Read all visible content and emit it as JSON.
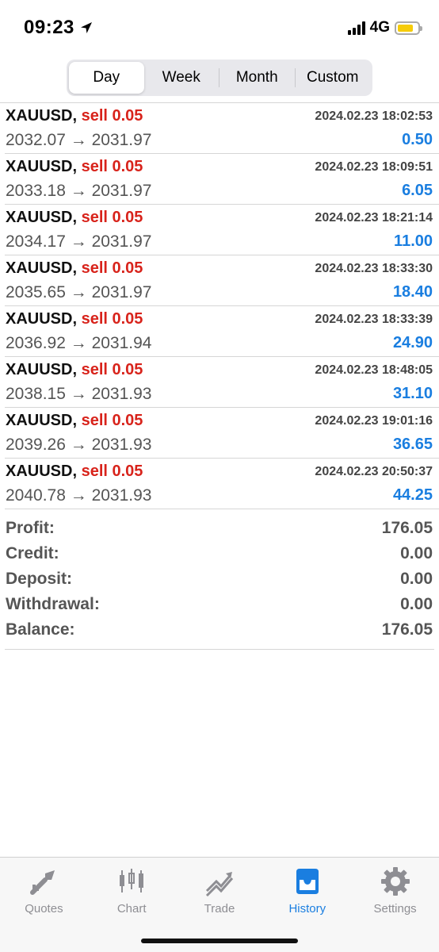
{
  "status_bar": {
    "time": "09:23",
    "network": "4G"
  },
  "periods": [
    {
      "label": "Day",
      "active": true
    },
    {
      "label": "Week",
      "active": false
    },
    {
      "label": "Month",
      "active": false
    },
    {
      "label": "Custom",
      "active": false
    }
  ],
  "deals": [
    {
      "symbol": "XAUUSD,",
      "type": "sell 0.05",
      "time": "2024.02.23 18:02:53",
      "prices": "2032.07 → 2031.97",
      "profit": "0.50"
    },
    {
      "symbol": "XAUUSD,",
      "type": "sell 0.05",
      "time": "2024.02.23 18:09:51",
      "prices": "2033.18 → 2031.97",
      "profit": "6.05"
    },
    {
      "symbol": "XAUUSD,",
      "type": "sell 0.05",
      "time": "2024.02.23 18:21:14",
      "prices": "2034.17 → 2031.97",
      "profit": "11.00"
    },
    {
      "symbol": "XAUUSD,",
      "type": "sell 0.05",
      "time": "2024.02.23 18:33:30",
      "prices": "2035.65 → 2031.97",
      "profit": "18.40"
    },
    {
      "symbol": "XAUUSD,",
      "type": "sell 0.05",
      "time": "2024.02.23 18:33:39",
      "prices": "2036.92 → 2031.94",
      "profit": "24.90"
    },
    {
      "symbol": "XAUUSD,",
      "type": "sell 0.05",
      "time": "2024.02.23 18:48:05",
      "prices": "2038.15 → 2031.93",
      "profit": "31.10"
    },
    {
      "symbol": "XAUUSD,",
      "type": "sell 0.05",
      "time": "2024.02.23 19:01:16",
      "prices": "2039.26 → 2031.93",
      "profit": "36.65"
    },
    {
      "symbol": "XAUUSD,",
      "type": "sell 0.05",
      "time": "2024.02.23 20:50:37",
      "prices": "2040.78 → 2031.93",
      "profit": "44.25"
    }
  ],
  "summary": [
    {
      "label": "Profit:",
      "value": "176.05"
    },
    {
      "label": "Credit:",
      "value": "0.00"
    },
    {
      "label": "Deposit:",
      "value": "0.00"
    },
    {
      "label": "Withdrawal:",
      "value": "0.00"
    },
    {
      "label": "Balance:",
      "value": "176.05"
    }
  ],
  "tab_bar": [
    {
      "label": "Quotes",
      "icon": "quotes-icon",
      "active": false
    },
    {
      "label": "Chart",
      "icon": "chart-icon",
      "active": false
    },
    {
      "label": "Trade",
      "icon": "trade-icon",
      "active": false
    },
    {
      "label": "History",
      "icon": "history-icon",
      "active": true
    },
    {
      "label": "Settings",
      "icon": "settings-icon",
      "active": false
    }
  ],
  "colors": {
    "accent": "#1a7ee0",
    "sell": "#d8231b",
    "battery": "#f6cc0a"
  }
}
